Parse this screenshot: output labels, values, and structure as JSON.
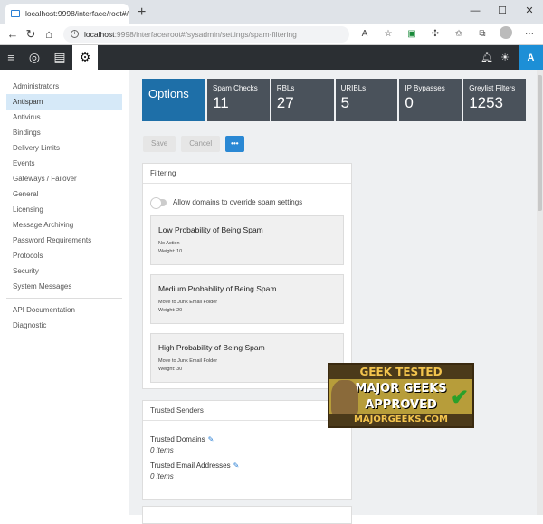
{
  "browser": {
    "tab_title": "localhost:9998/interface/root#/s",
    "tab_close": "✕",
    "new_tab": "+",
    "window_controls": [
      "—",
      "☐",
      "✕"
    ],
    "url_host": "localhost",
    "url_path": ":9998/interface/root#/sysadmin/settings/spam-filtering"
  },
  "app": {
    "avatar_initial": "A"
  },
  "sidebar": {
    "items": [
      "Administrators",
      "Antispam",
      "Antivirus",
      "Bindings",
      "Delivery Limits",
      "Events",
      "Gateways / Failover",
      "General",
      "Licensing",
      "Message Archiving",
      "Password Requirements",
      "Protocols",
      "Security",
      "System Messages"
    ],
    "active_index": 1,
    "secondary": [
      "API Documentation",
      "Diagnostic"
    ]
  },
  "stats": {
    "options_label": "Options",
    "items": [
      {
        "label": "Spam Checks",
        "value": "11"
      },
      {
        "label": "RBLs",
        "value": "27"
      },
      {
        "label": "URIBLs",
        "value": "5"
      },
      {
        "label": "IP Bypasses",
        "value": "0"
      },
      {
        "label": "Greylist Filters",
        "value": "1253"
      }
    ]
  },
  "actions": {
    "save": "Save",
    "cancel": "Cancel",
    "more": "•••"
  },
  "filtering": {
    "header": "Filtering",
    "toggle_label": "Allow domains to override spam settings",
    "levels": [
      {
        "title": "Low Probability of Being Spam",
        "action": "No Action",
        "weight": "Weight: 10"
      },
      {
        "title": "Medium Probability of Being Spam",
        "action": "Move to Junk Email Folder",
        "weight": "Weight: 20"
      },
      {
        "title": "High Probability of Being Spam",
        "action": "Move to Junk Email Folder",
        "weight": "Weight: 30"
      }
    ]
  },
  "trusted": {
    "header": "Trusted Senders",
    "domains_label": "Trusted Domains",
    "domains_count": "0 items",
    "emails_label": "Trusted Email Addresses",
    "emails_count": "0 items"
  },
  "badge": {
    "top": "GEEK TESTED",
    "line1": "MAJOR GEEKS",
    "line2": "APPROVED",
    "bottom": "MAJORGEEKS.COM"
  },
  "colors": {
    "accent": "#1e6fa8",
    "stat_bg": "#4a525b",
    "header_bg": "#2b2f33",
    "avatar": "#1d8fd6"
  }
}
